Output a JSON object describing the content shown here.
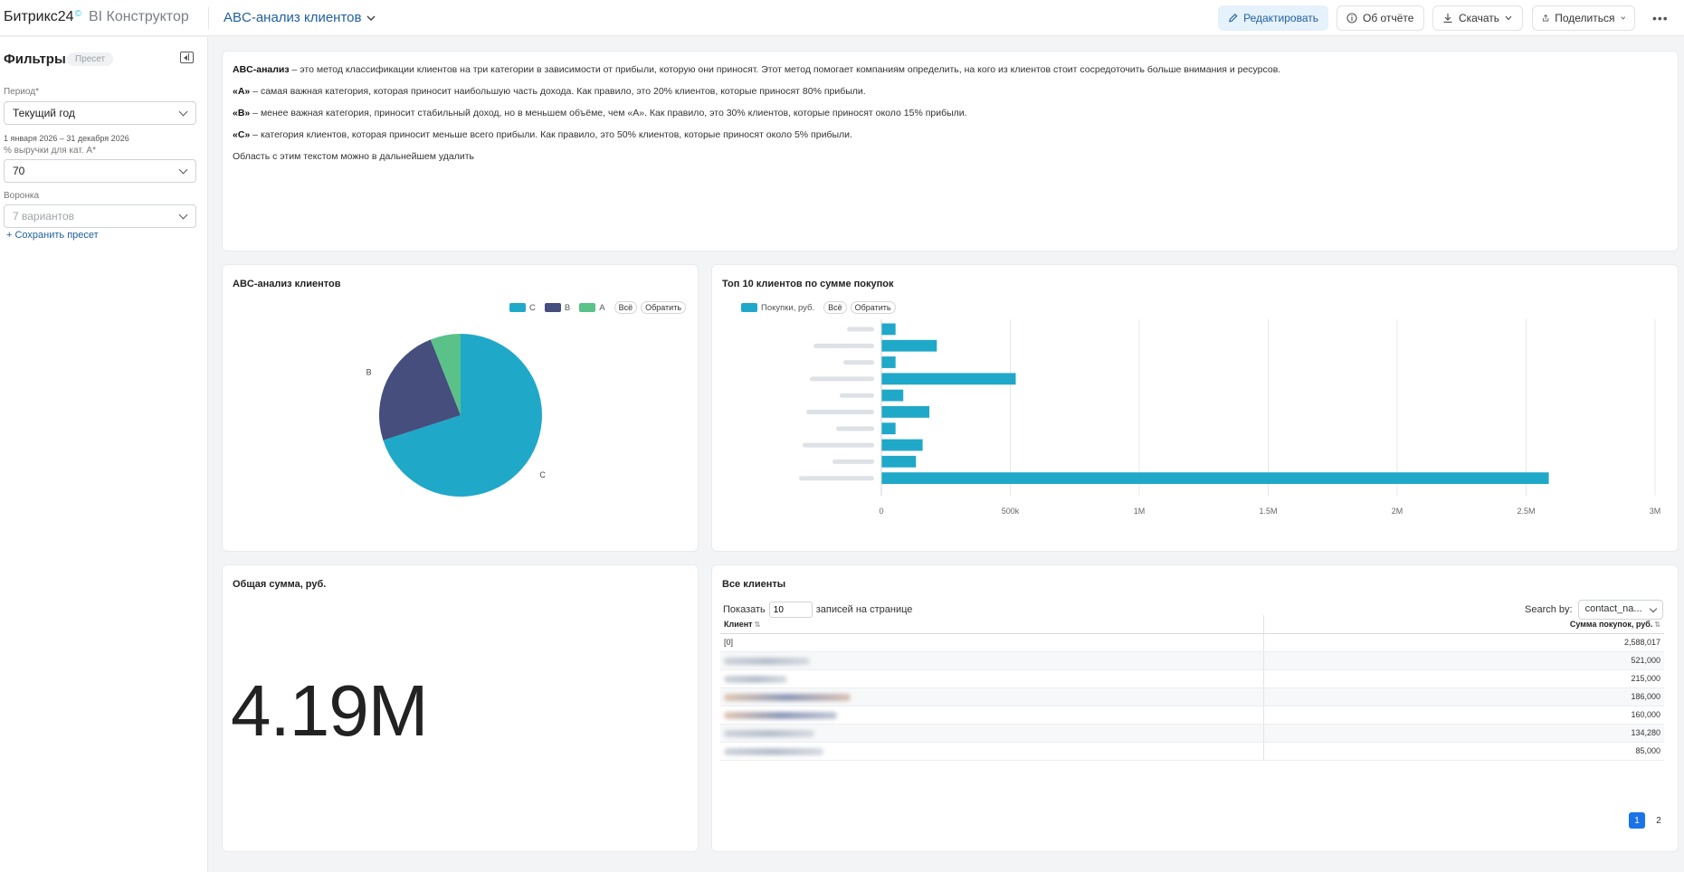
{
  "header": {
    "brand_main": "Битрикс24",
    "brand_mark": "©",
    "brand_product": "BI Конструктор",
    "report_title": "ABC-анализ клиентов",
    "buttons": {
      "edit": "Редактировать",
      "about": "Об отчёте",
      "download": "Скачать",
      "share": "Поделиться",
      "more": "•••"
    }
  },
  "sidebar": {
    "title": "Фильтры",
    "preset_badge": "Пресет",
    "period_label": "Период*",
    "period_value": "Текущий год",
    "period_range": "1 января 2026 – 31 декабря 2026",
    "revenue_label": "% выручки для кат. А*",
    "revenue_value": "70",
    "funnel_label": "Воронка",
    "funnel_placeholder": "7 вариантов",
    "save_preset": "+ Сохранить пресет"
  },
  "intro": {
    "p1_bold": "ABC-анализ",
    "p1_text": " – это метод классификации клиентов на три категории в зависимости от прибыли, которую они приносят. Этот метод помогает компаниям определить, на кого из клиентов стоит сосредоточить больше внимания и ресурсов.",
    "p2_bold": "«А»",
    "p2_text": " – самая важная категория, которая приносит наибольшую часть дохода. Как правило, это 20% клиентов, которые приносят 80% прибыли.",
    "p3_bold": "«B»",
    "p3_text": " – менее важная категория, приносит стабильный доход, но в меньшем объёме, чем «А». Как правило, это 30% клиентов, которые приносят около 15% прибыли.",
    "p4_bold": "«C»",
    "p4_text": " – категория клиентов, которая приносит меньше всего прибыли. Как правило, это 50% клиентов, которые приносят около 5% прибыли.",
    "p5_text": "Область с этим текстом можно в дальнейшем удалить"
  },
  "legend_controls": {
    "all": "Всё",
    "invert": "Обратить"
  },
  "pie_card": {
    "title": "ABC-анализ клиентов"
  },
  "bar_card": {
    "title": "Топ 10 клиентов по сумме покупок",
    "series_label": "Покупки, руб."
  },
  "total_card": {
    "title": "Общая сумма, руб.",
    "value": "4.19M"
  },
  "table_card": {
    "title": "Все клиенты",
    "show_label": "Показать",
    "page_size": "10",
    "per_page_label": "записей на странице",
    "search_label": "Search by:",
    "search_value": "contact_na...",
    "col_client": "Клиент",
    "col_sum": "Сумма покупок, руб.",
    "rows": [
      {
        "client": "[0]",
        "sum": "2,588,017"
      },
      {
        "client": "",
        "sum": "521,000"
      },
      {
        "client": "",
        "sum": "215,000"
      },
      {
        "client": "",
        "sum": "186,000"
      },
      {
        "client": "",
        "sum": "160,000"
      },
      {
        "client": "",
        "sum": "134,280"
      },
      {
        "client": "",
        "sum": "85,000"
      }
    ],
    "pages": [
      "1",
      "2"
    ]
  },
  "colors": {
    "C": "#20a8c9",
    "B": "#454e7c",
    "A": "#5ac189"
  },
  "chart_data": [
    {
      "type": "pie",
      "title": "ABC-анализ клиентов",
      "categories": [
        "C",
        "B",
        "A"
      ],
      "values": [
        70,
        24,
        6
      ],
      "legend": "top-right"
    },
    {
      "type": "bar",
      "orientation": "horizontal",
      "title": "Топ 10 клиентов по сумме покупок",
      "series": [
        {
          "name": "Покупки, руб.",
          "values": [
            55000,
            215000,
            55000,
            521000,
            85000,
            186000,
            55000,
            160000,
            134280,
            2588017
          ]
        }
      ],
      "xlim": [
        0,
        3000000
      ],
      "xticks": [
        "0",
        "500k",
        "1M",
        "1.5M",
        "2M",
        "2.5M",
        "3M"
      ],
      "grid": true,
      "legend": "top-left"
    }
  ]
}
